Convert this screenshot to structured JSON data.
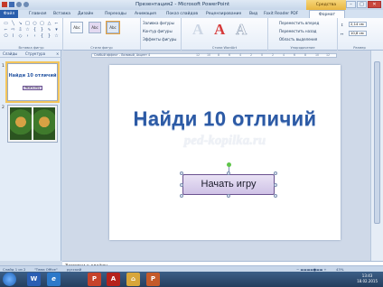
{
  "window": {
    "title": "Презентация2 - Microsoft PowerPoint",
    "context_tab": "Средства рисования",
    "controls": [
      "–",
      "□",
      "✕"
    ]
  },
  "tabs": [
    "Файл",
    "Главная",
    "Вставка",
    "Дизайн",
    "Переходы",
    "Анимация",
    "Показ слайдов",
    "Рецензирование",
    "Вид",
    "Foxit Reader PDF",
    "Формат"
  ],
  "ribbon": {
    "groups": {
      "insert_shapes": "Вставка фигур",
      "shape_styles": "Стили фигур",
      "wordart_styles": "Стили WordArt",
      "arrange": "Упорядочение",
      "size": "Размер"
    },
    "style_boxes": [
      "Abc",
      "Abc",
      "Abc"
    ],
    "shape_fill": "Заливка фигуры",
    "shape_outline": "Контур фигуры",
    "shape_effects": "Эффекты фигуры",
    "bring_forward": "Переместить вперед",
    "send_backward": "Переместить назад",
    "selection_pane": "Область выделения",
    "height": "2,14 см",
    "width": "10,8 см",
    "wordart_letters": [
      "A",
      "A",
      "A"
    ]
  },
  "ruler_label": "Слабый эффект - Лиловый, Акцент 4",
  "ruler_ticks": [
    "12",
    "10",
    "8",
    "6",
    "4",
    "2",
    "0",
    "2",
    "4",
    "6",
    "8",
    "10",
    "12"
  ],
  "panel": {
    "tabs": [
      "Слайды",
      "Структура"
    ],
    "thumbs": [
      {
        "num": "1",
        "title": "Найди 10 отличий",
        "button": "Начать игру"
      },
      {
        "num": "2"
      }
    ]
  },
  "slide": {
    "title": "Найди 10 отличий",
    "watermark": "ped-kopilka.ru",
    "button_text": "Начать игру"
  },
  "notes_placeholder": "Заметки к слайду",
  "status": {
    "slide": "Слайд 1 из 2",
    "theme": "\"Тема Office\"",
    "language": "русский",
    "zoom": "43%"
  },
  "taskbar": {
    "apps": [
      "W",
      "e",
      "P",
      "A",
      "⌂",
      "P"
    ],
    "time": "13:43",
    "date": "18.02.2015"
  },
  "colors": {
    "title_blue": "#2c5aa5",
    "file_tab": "#2a5fad",
    "button_border": "#6a5290"
  }
}
